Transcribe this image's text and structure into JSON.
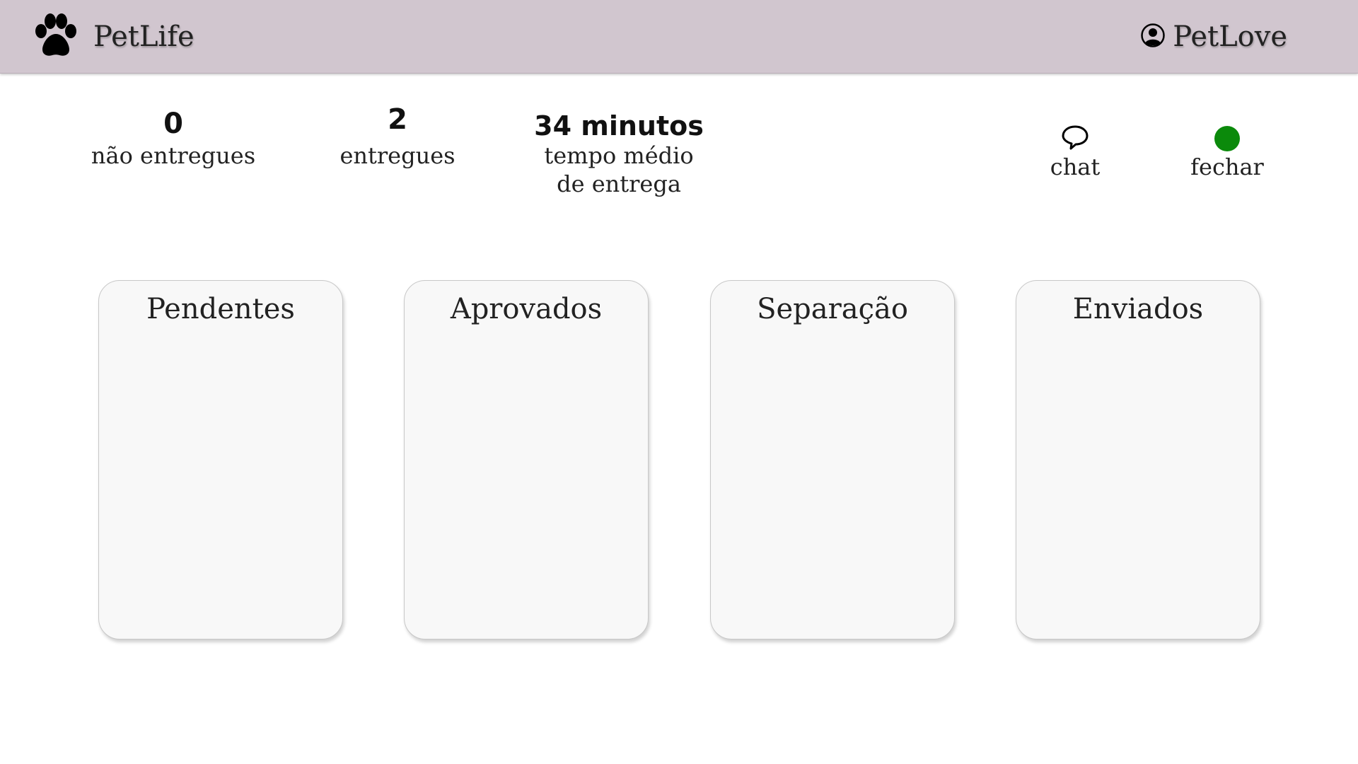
{
  "header": {
    "app_name": "PetLife",
    "user_name": "PetLove",
    "background_color": "#d1c6cf"
  },
  "stats": [
    {
      "value": "0",
      "label": "não entregues"
    },
    {
      "value": "2",
      "label": "entregues"
    },
    {
      "value": "34 minutos",
      "label": "tempo médio\n de entrega"
    }
  ],
  "actions": {
    "chat_label": "chat",
    "close_label": "fechar",
    "status_color": "#0b8a0b"
  },
  "columns": [
    {
      "title": "Pendentes",
      "items": []
    },
    {
      "title": "Aprovados",
      "items": []
    },
    {
      "title": "Separação",
      "items": []
    },
    {
      "title": "Enviados",
      "items": []
    }
  ],
  "icons": {
    "logo": "paw-icon",
    "user": "user-circle-icon",
    "chat": "speech-bubble-icon",
    "status": "status-dot-icon"
  }
}
